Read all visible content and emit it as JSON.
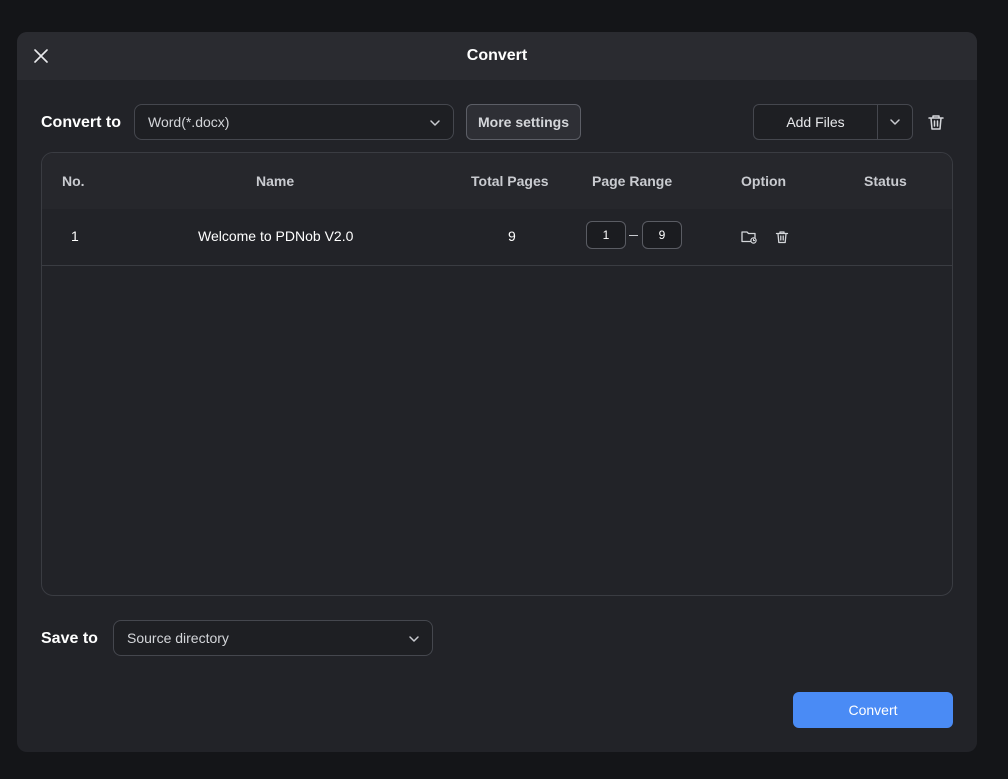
{
  "dialog": {
    "title": "Convert",
    "close_icon": "close-icon"
  },
  "convert_to": {
    "label": "Convert to",
    "selected": "Word(*.docx)",
    "more_settings": "More settings",
    "add_files": "Add Files"
  },
  "table": {
    "headers": {
      "no": "No.",
      "name": "Name",
      "total_pages": "Total Pages",
      "page_range": "Page Range",
      "option": "Option",
      "status": "Status"
    },
    "rows": [
      {
        "no": "1",
        "name": "Welcome to PDNob V2.0",
        "total_pages": "9",
        "range_from": "1",
        "range_to": "9",
        "status": ""
      }
    ]
  },
  "save_to": {
    "label": "Save to",
    "selected": "Source directory"
  },
  "footer": {
    "convert_label": "Convert"
  },
  "colors": {
    "accent": "#4a8bf5",
    "background": "#222328",
    "titlebar": "#2a2b30"
  }
}
